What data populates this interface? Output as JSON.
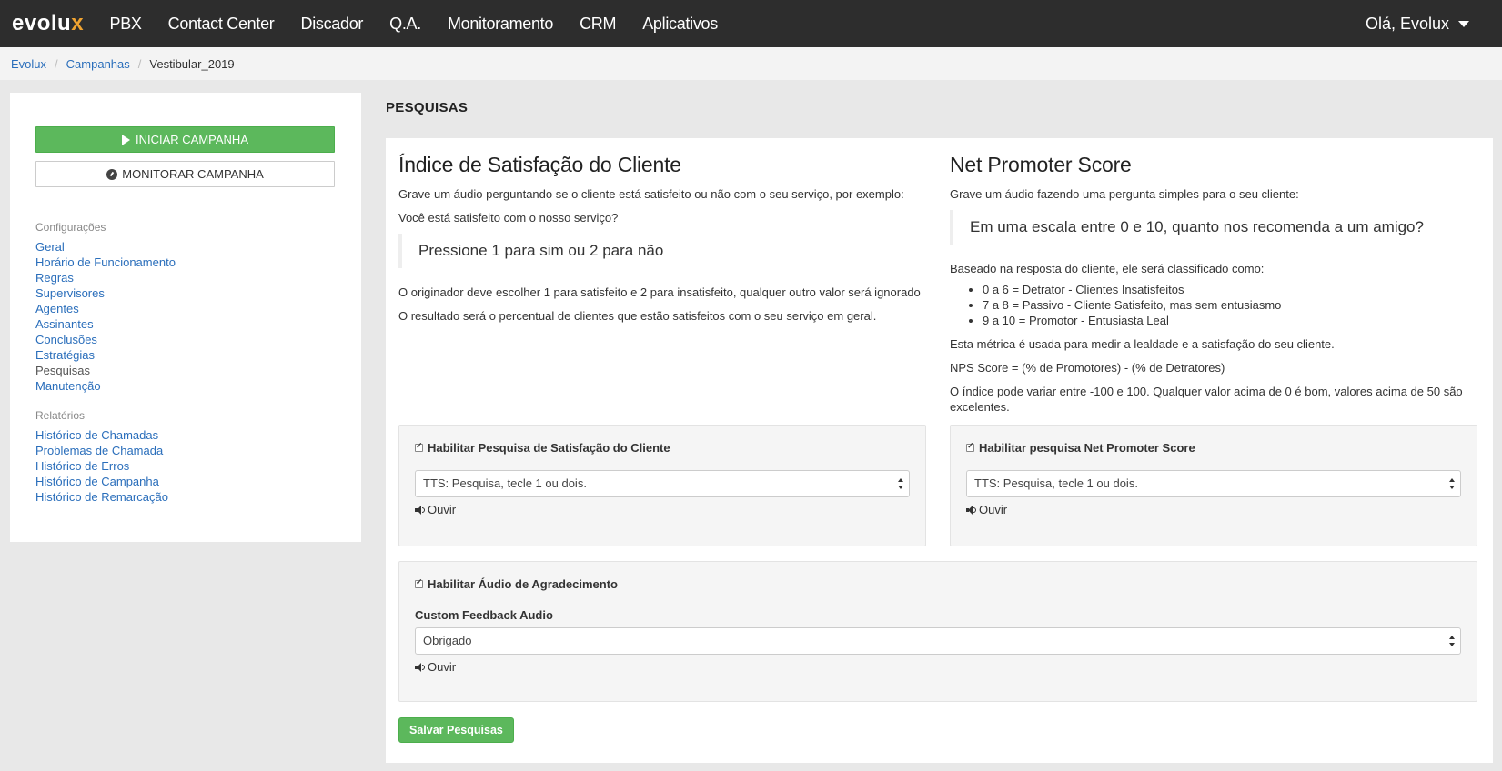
{
  "app": {
    "logo_text": "evolux",
    "nav": [
      "PBX",
      "Contact Center",
      "Discador",
      "Q.A.",
      "Monitoramento",
      "CRM",
      "Aplicativos"
    ],
    "user_greeting": "Olá, Evolux"
  },
  "breadcrumb": [
    "Evolux",
    "Campanhas",
    "Vestibular_2019"
  ],
  "sidebar": {
    "start_button": "INICIAR CAMPANHA",
    "monitor_button": "MONITORAR CAMPANHA",
    "config_label": "Configurações",
    "config_items": [
      "Geral",
      "Horário de Funcionamento",
      "Regras",
      "Supervisores",
      "Agentes",
      "Assinantes",
      "Conclusões",
      "Estratégias",
      "Pesquisas",
      "Manutenção"
    ],
    "reports_label": "Relatórios",
    "report_items": [
      "Histórico de Chamadas",
      "Problemas de Chamada",
      "Histórico de Erros",
      "Histórico de Campanha",
      "Histórico de Remarcação"
    ]
  },
  "main": {
    "title": "PESQUISAS",
    "csat": {
      "heading": "Índice de Satisfação do Cliente",
      "intro": "Grave um áudio perguntando se o cliente está satisfeito ou não com o seu serviço, por exemplo:",
      "question": "Você está satisfeito com o nosso serviço?",
      "quote": "Pressione 1 para sim ou 2 para não",
      "para1": "O originador deve escolher 1 para satisfeito e 2 para insatisfeito, qualquer outro valor será ignorado",
      "para2": "O resultado será o percentual de clientes que estão satisfeitos com o seu serviço em geral."
    },
    "nps": {
      "heading": "Net Promoter Score",
      "intro": "Grave um áudio fazendo uma pergunta simples para o seu cliente:",
      "quote": "Em uma escala entre 0 e 10, quanto nos recomenda a um amigo?",
      "classify": "Baseado na resposta do cliente, ele será classificado como:",
      "list": [
        "0 a 6 = Detrator - Clientes Insatisfeitos",
        "7 a 8 = Passivo - Cliente Satisfeito, mas sem entusiasmo",
        "9 a 10 = Promotor - Entusiasta Leal"
      ],
      "metric": "Esta métrica é usada para medir a lealdade e a satisfação do seu cliente.",
      "formula": "NPS Score = (% de Promotores) - (% de Detratores)",
      "range": "O índice pode variar entre -100 e 100. Qualquer valor acima de 0 é bom, valores acima de 50 são excelentes."
    },
    "csat_panel": {
      "checkbox_label": "Habilitar Pesquisa de Satisfação do Cliente",
      "select_value": "TTS: Pesquisa, tecle 1 ou dois.",
      "listen": "Ouvir"
    },
    "nps_panel": {
      "checkbox_label": "Habilitar pesquisa Net Promoter Score",
      "select_value": "TTS: Pesquisa, tecle 1 ou dois.",
      "listen": "Ouvir"
    },
    "thanks_panel": {
      "checkbox_label": "Habilitar Áudio de Agradecimento",
      "field_label": "Custom Feedback Audio",
      "select_value": "Obrigado",
      "listen": "Ouvir"
    },
    "save_button": "Salvar Pesquisas"
  }
}
